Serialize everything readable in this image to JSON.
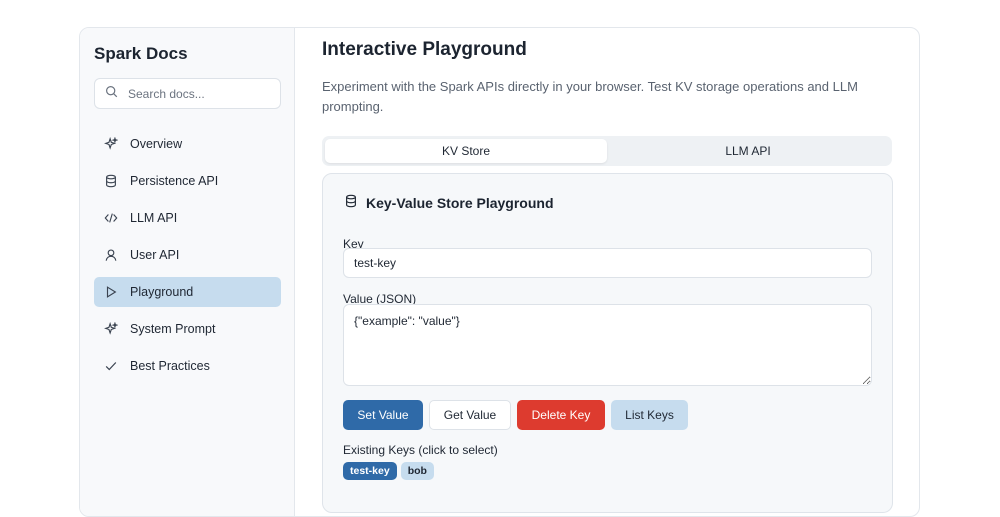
{
  "sidebar": {
    "brand": "Spark Docs",
    "search_placeholder": "Search docs...",
    "items": [
      {
        "label": "Overview",
        "icon": "sparkle-icon"
      },
      {
        "label": "Persistence API",
        "icon": "database-icon"
      },
      {
        "label": "LLM API",
        "icon": "code-icon"
      },
      {
        "label": "User API",
        "icon": "user-icon"
      },
      {
        "label": "Playground",
        "icon": "play-icon",
        "active": true
      },
      {
        "label": "System Prompt",
        "icon": "sparkle-icon"
      },
      {
        "label": "Best Practices",
        "icon": "check-icon"
      }
    ]
  },
  "main": {
    "title": "Interactive Playground",
    "description": "Experiment with the Spark APIs directly in your browser. Test KV storage operations and LLM prompting.",
    "tabs": [
      {
        "label": "KV Store",
        "active": true
      },
      {
        "label": "LLM API",
        "active": false
      }
    ],
    "card": {
      "title": "Key-Value Store Playground",
      "key_label": "Key",
      "key_value": "test-key",
      "value_label": "Value (JSON)",
      "value_value": "{\"example\": \"value\"}",
      "buttons": {
        "set": "Set Value",
        "get": "Get Value",
        "delete": "Delete Key",
        "list": "List Keys"
      },
      "existing_keys_label": "Existing Keys (click to select)",
      "existing_keys": [
        "test-key",
        "bob"
      ]
    }
  },
  "colors": {
    "accent": "#2f6aa8",
    "danger": "#dd3b2f",
    "active_bg": "#c6dcee"
  }
}
